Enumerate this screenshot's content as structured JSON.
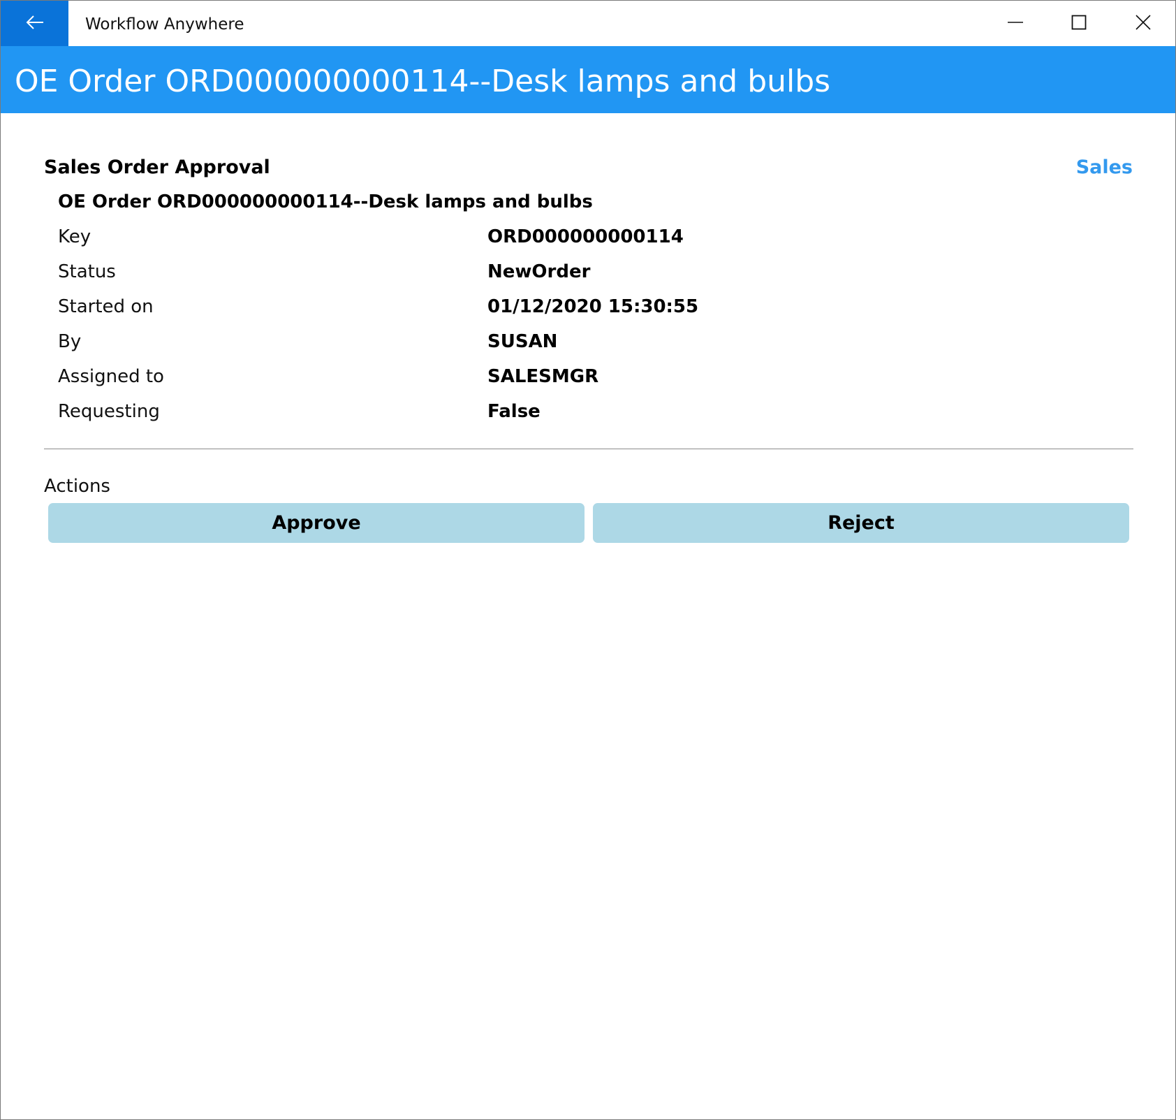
{
  "window": {
    "app_title": "Workflow Anywhere",
    "controls": [
      "minimize-icon",
      "maximize-icon",
      "close-icon"
    ],
    "back_icon": "arrow-left-icon"
  },
  "header": {
    "title": "OE Order ORD000000000114--Desk lamps and bulbs",
    "color": "#2196f3"
  },
  "workflow": {
    "section_title": "Sales Order Approval",
    "category": "Sales",
    "order_title": "OE Order ORD000000000114--Desk lamps and bulbs",
    "details": [
      {
        "label": "Key",
        "value": "ORD000000000114"
      },
      {
        "label": "Status",
        "value": "NewOrder"
      },
      {
        "label": "Started on",
        "value": "01/12/2020 15:30:55"
      },
      {
        "label": "By",
        "value": "SUSAN"
      },
      {
        "label": "Assigned to",
        "value": "SALESMGR"
      },
      {
        "label": "Requesting",
        "value": "False"
      }
    ]
  },
  "actions": {
    "label": "Actions",
    "approve_label": "Approve",
    "reject_label": "Reject",
    "button_color": "#add8e6"
  }
}
